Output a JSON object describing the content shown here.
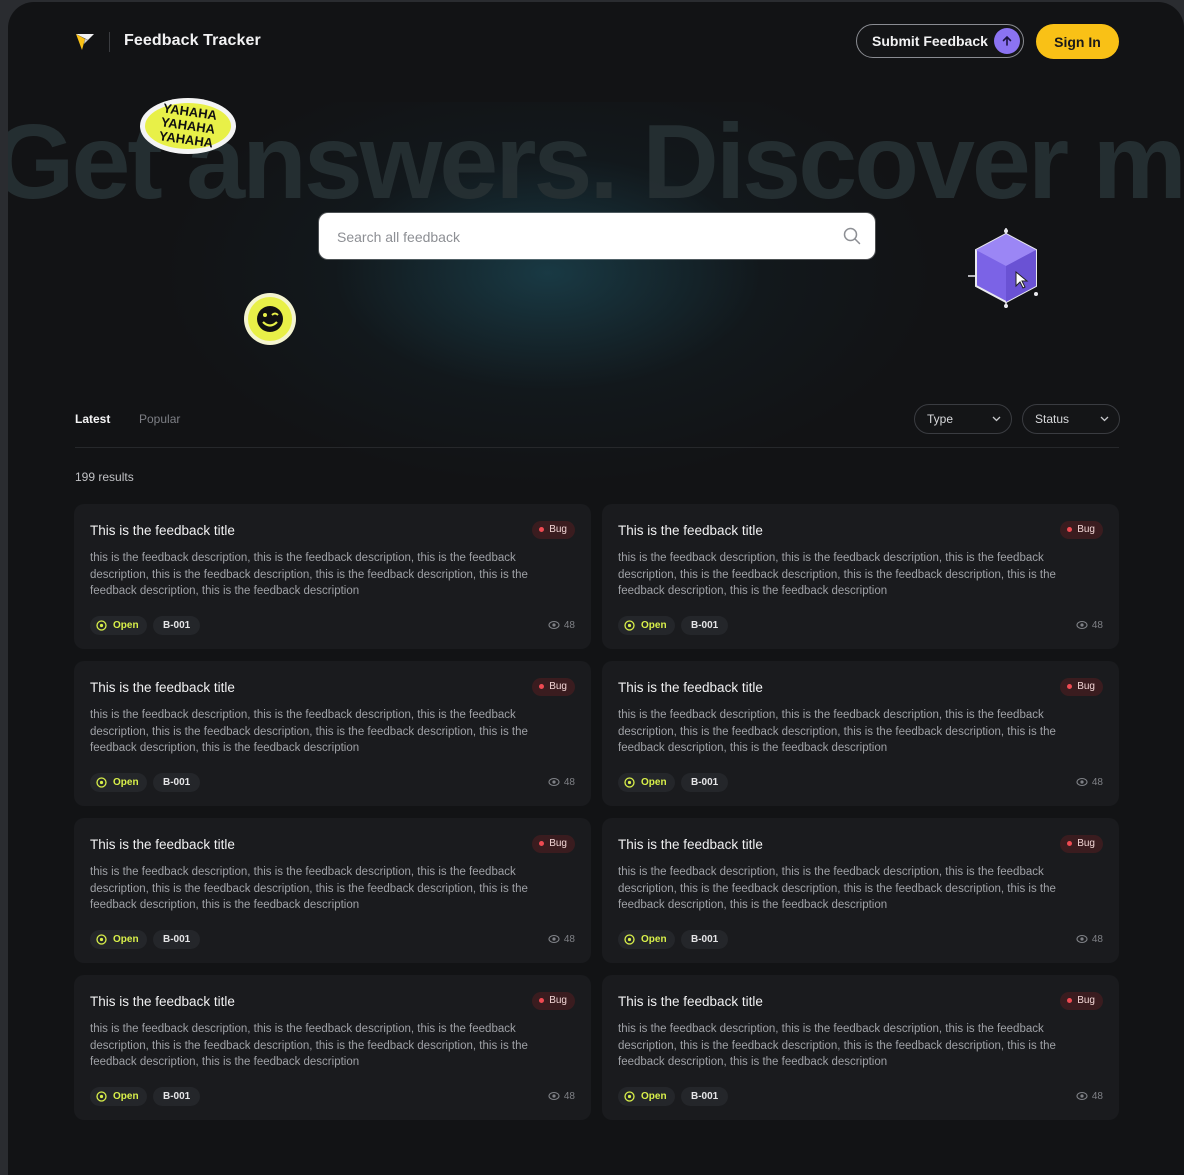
{
  "header": {
    "brand": "Feedback Tracker",
    "submit_label": "Submit Feedback",
    "signin_label": "Sign In"
  },
  "hero": {
    "headline": "Get answers. Discover more",
    "sticker_text": "YAHAHA"
  },
  "search": {
    "placeholder": "Search all feedback"
  },
  "tabs": [
    {
      "label": "Latest",
      "active": true
    },
    {
      "label": "Popular",
      "active": false
    }
  ],
  "filters": [
    {
      "label": "Type"
    },
    {
      "label": "Status"
    }
  ],
  "results_text": "199 results",
  "colors": {
    "accent_yellow": "#f9c116",
    "accent_purple": "#8b73f2",
    "bug_red": "#ef4a52",
    "open_green": "#d9f04a"
  },
  "cards": [
    {
      "title": "This is the feedback title",
      "type": "Bug",
      "description": "this is the feedback description, this is the feedback description, this is the feedback description, this is the feedback description, this is the feedback description, this is the feedback description, this is the feedback description",
      "status": "Open",
      "id": "B-001",
      "views": "48"
    },
    {
      "title": "This is the feedback title",
      "type": "Bug",
      "description": "this is the feedback description, this is the feedback description, this is the feedback description, this is the feedback description, this is the feedback description, this is the feedback description, this is the feedback description",
      "status": "Open",
      "id": "B-001",
      "views": "48"
    },
    {
      "title": "This is the feedback title",
      "type": "Bug",
      "description": "this is the feedback description, this is the feedback description, this is the feedback description, this is the feedback description, this is the feedback description, this is the feedback description, this is the feedback description",
      "status": "Open",
      "id": "B-001",
      "views": "48"
    },
    {
      "title": "This is the feedback title",
      "type": "Bug",
      "description": "this is the feedback description, this is the feedback description, this is the feedback description, this is the feedback description, this is the feedback description, this is the feedback description, this is the feedback description",
      "status": "Open",
      "id": "B-001",
      "views": "48"
    },
    {
      "title": "This is the feedback title",
      "type": "Bug",
      "description": "this is the feedback description, this is the feedback description, this is the feedback description, this is the feedback description, this is the feedback description, this is the feedback description, this is the feedback description",
      "status": "Open",
      "id": "B-001",
      "views": "48"
    },
    {
      "title": "This is the feedback title",
      "type": "Bug",
      "description": "this is the feedback description, this is the feedback description, this is the feedback description, this is the feedback description, this is the feedback description, this is the feedback description, this is the feedback description",
      "status": "Open",
      "id": "B-001",
      "views": "48"
    },
    {
      "title": "This is the feedback title",
      "type": "Bug",
      "description": "this is the feedback description, this is the feedback description, this is the feedback description, this is the feedback description, this is the feedback description, this is the feedback description, this is the feedback description",
      "status": "Open",
      "id": "B-001",
      "views": "48"
    },
    {
      "title": "This is the feedback title",
      "type": "Bug",
      "description": "this is the feedback description, this is the feedback description, this is the feedback description, this is the feedback description, this is the feedback description, this is the feedback description, this is the feedback description",
      "status": "Open",
      "id": "B-001",
      "views": "48"
    }
  ]
}
